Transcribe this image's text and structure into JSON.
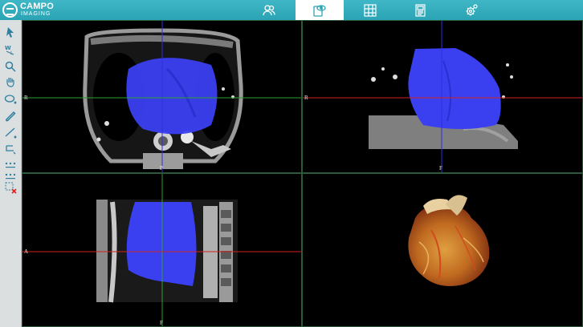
{
  "app": {
    "logo_line1": "CAMPO",
    "logo_line2": "IMAGING"
  },
  "tabs": [
    {
      "icon": "users-icon",
      "active": false
    },
    {
      "icon": "view-icon",
      "active": true
    },
    {
      "icon": "grid-report-icon",
      "active": false
    },
    {
      "icon": "document-icon",
      "active": false
    },
    {
      "icon": "settings-icon",
      "active": false
    }
  ],
  "tools": [
    "select-arrow-icon",
    "window-level-icon",
    "zoom-icon",
    "pan-hand-icon",
    "ellipse-roi-icon",
    "pencil-icon",
    "line-measure-icon",
    "angle-icon",
    "dotted-line-icon",
    "dotted-line-2-icon",
    "clear-annotations-icon"
  ],
  "viewports": {
    "axial": {
      "left_label": "R",
      "bottom_label": "P"
    },
    "coronal": {
      "left_label": "R",
      "bottom_label": "F"
    },
    "sagittal": {
      "left_label": "A",
      "bottom_label": "F"
    },
    "volume": {}
  },
  "colors": {
    "header": "#2aa3b4",
    "segmentation": "#3a3ff0",
    "crosshair_vertical": "#2f2fe0",
    "crosshair_axial_h": "#2ea02e",
    "crosshair_other_h": "#d62020"
  }
}
